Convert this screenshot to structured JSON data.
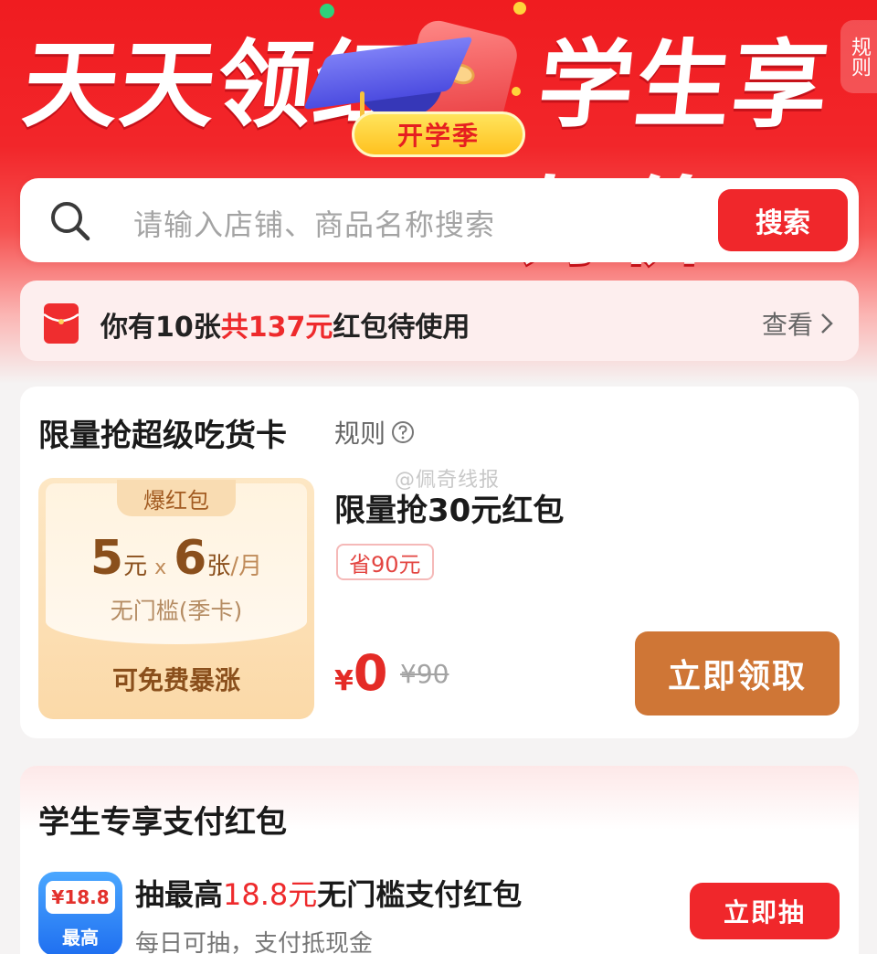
{
  "hero": {
    "title_left": "天天领红包",
    "title_right": "学生享好价",
    "season_label": "开学季",
    "rules_tab": "规则"
  },
  "search": {
    "placeholder": "请输入店铺、商品名称搜索",
    "button_label": "搜索",
    "icon": "search-icon"
  },
  "notice": {
    "icon": "red-envelope-icon",
    "text_prefix": "你有10张",
    "text_highlight": "共137元",
    "text_suffix": "红包待使用",
    "link_label": "查看"
  },
  "food_card": {
    "title": "限量抢超级吃货卡",
    "rules_label": "规则",
    "watermark": "@佩奇线报",
    "ticket": {
      "badge": "爆红包",
      "amount": "5",
      "amount_unit": "元",
      "times_sign": "x",
      "count": "6",
      "count_unit": "张",
      "period": "/月",
      "condition": "无门槛(季卡)",
      "footer": "可免费暴涨"
    },
    "offer_title": "限量抢30元红包",
    "save_tag": "省90元",
    "price_symbol": "¥",
    "price_now": "0",
    "price_old": "¥90",
    "claim_label": "立即领取"
  },
  "student_card": {
    "title": "学生专享支付红包",
    "app_icon": {
      "coupon_text": "¥18.8",
      "label": "最高"
    },
    "draw_title_prefix": "抽最高",
    "draw_title_highlight": "18.8元",
    "draw_title_suffix": "无门槛支付红包",
    "draw_subtitle": "每日可抽，支付抵现金",
    "draw_button": "立即抽"
  },
  "colors": {
    "brand_red": "#f0272b",
    "claim_orange": "#cf7636",
    "ticket_brown": "#8a4f1c"
  }
}
